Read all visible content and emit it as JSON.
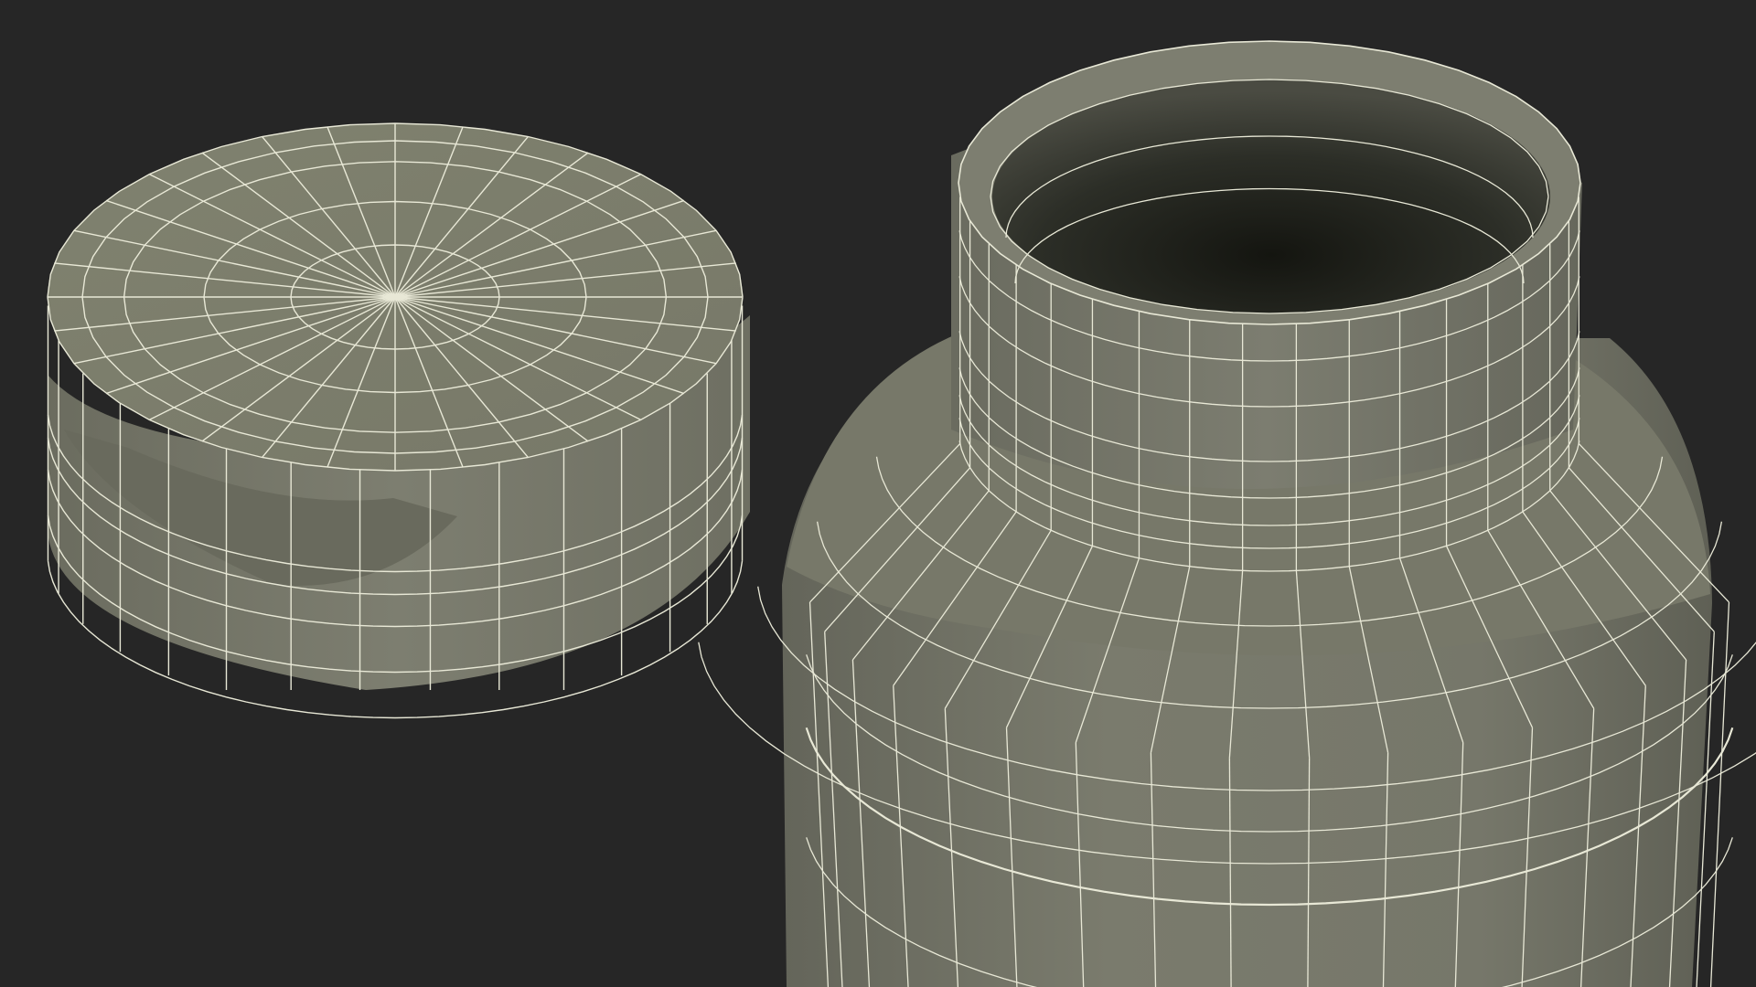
{
  "scene": {
    "background_color": "#262626",
    "surface_color": "#7a7b6d",
    "surface_shadow_color": "#5f6055",
    "interior_dark_color": "#1f211c",
    "wire_color": "#e8e8d6",
    "objects": [
      {
        "name": "bottle-cap",
        "kind": "wireframe-cap-lid",
        "radial_segments": 32
      },
      {
        "name": "bottle",
        "kind": "wireframe-bottle-open-neck",
        "radial_segments": 32
      }
    ]
  }
}
